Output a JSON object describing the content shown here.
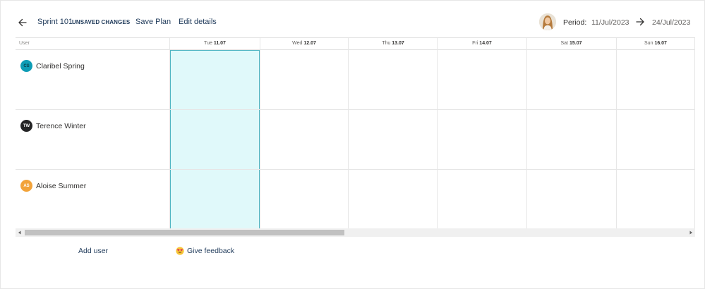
{
  "header": {
    "sprint_name": "Sprint 101",
    "unsaved_label": "UNSAVED CHANGES",
    "save_plan_label": "Save Plan",
    "edit_details_label": "Edit details",
    "period_label": "Period:",
    "period_start": "11/Jul/2023",
    "period_end": "24/Jul/2023"
  },
  "grid": {
    "user_column_header": "User",
    "days": [
      {
        "weekday": "Tue",
        "date": "11.07"
      },
      {
        "weekday": "Wed",
        "date": "12.07"
      },
      {
        "weekday": "Thu",
        "date": "13.07"
      },
      {
        "weekday": "Fri",
        "date": "14.07"
      },
      {
        "weekday": "Sat",
        "date": "15.07"
      },
      {
        "weekday": "Sun",
        "date": "16.07"
      }
    ],
    "users": [
      {
        "initials": "CS",
        "name": "Claribel Spring",
        "color": "#0e9cb5"
      },
      {
        "initials": "TW",
        "name": "Terence Winter",
        "color": "#252526"
      },
      {
        "initials": "AS",
        "name": "Aloise Summer",
        "color": "#f2a33a"
      }
    ]
  },
  "footer": {
    "add_user_label": "Add user",
    "feedback_label": "Give feedback"
  },
  "colors": {
    "accent": "#1f3a5a",
    "today_fill": "#e0f9fa",
    "today_border": "#4fb5c2"
  },
  "scroll": {
    "horizontal_position_fraction": 0.0,
    "visible_fraction": 0.47
  }
}
